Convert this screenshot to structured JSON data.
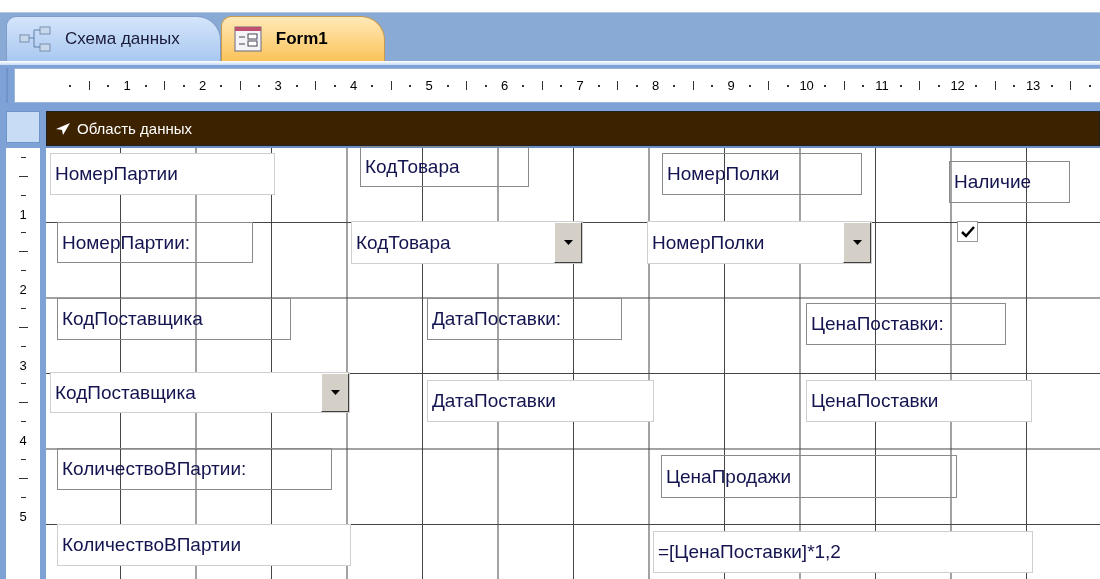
{
  "tabs": [
    {
      "label": "Схема данных",
      "selected": false
    },
    {
      "label": "Form1",
      "selected": true
    }
  ],
  "ruler": {
    "horizontal": [
      "1",
      "2",
      "3",
      "4",
      "5",
      "6",
      "7",
      "8",
      "9",
      "10",
      "11",
      "12",
      "13"
    ],
    "vertical": [
      "1",
      "2",
      "3",
      "4",
      "5"
    ]
  },
  "section": {
    "title": "Область данных"
  },
  "controls": [
    {
      "kind": "textbox",
      "text": "НомерПартии"
    },
    {
      "kind": "label",
      "text": "КодТовара"
    },
    {
      "kind": "label",
      "text": "НомерПолки"
    },
    {
      "kind": "label",
      "text": "Наличие"
    },
    {
      "kind": "label",
      "text": "НомерПартии:"
    },
    {
      "kind": "combo",
      "text": "КодТовара"
    },
    {
      "kind": "combo",
      "text": "НомерПолки"
    },
    {
      "kind": "checkbox",
      "checked": true
    },
    {
      "kind": "label",
      "text": "КодПоставщика"
    },
    {
      "kind": "label",
      "text": "ДатаПоставки:"
    },
    {
      "kind": "label",
      "text": "ЦенаПоставки:"
    },
    {
      "kind": "combo",
      "text": "КодПоставщика"
    },
    {
      "kind": "textbox",
      "text": "ДатаПоставки"
    },
    {
      "kind": "textbox",
      "text": "ЦенаПоставки"
    },
    {
      "kind": "label",
      "text": "КоличествоВПартии:"
    },
    {
      "kind": "label",
      "text": "ЦенаПродажи"
    },
    {
      "kind": "textbox",
      "text": "КоличествоВПартии"
    },
    {
      "kind": "textbox",
      "text": "=[ЦенаПоставки]*1,2"
    }
  ]
}
